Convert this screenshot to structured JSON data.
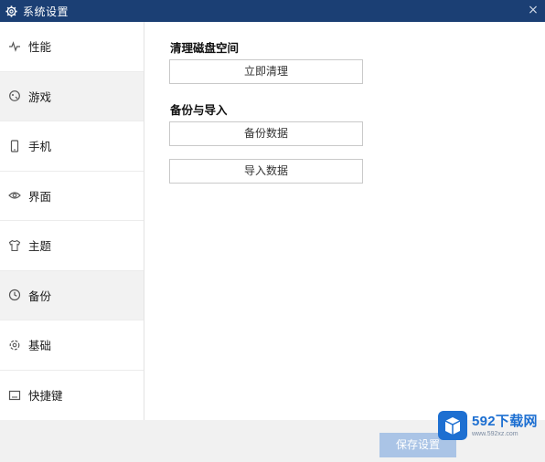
{
  "window": {
    "title": "系统设置",
    "icon": "gear-icon",
    "close_glyph": "×"
  },
  "sidebar": {
    "items": [
      {
        "label": "性能",
        "icon": "pulse-icon",
        "active": false
      },
      {
        "label": "游戏",
        "icon": "gamepad-icon",
        "active": true
      },
      {
        "label": "手机",
        "icon": "phone-icon",
        "active": false
      },
      {
        "label": "界面",
        "icon": "eye-icon",
        "active": false
      },
      {
        "label": "主题",
        "icon": "shirt-icon",
        "active": false
      },
      {
        "label": "备份",
        "icon": "clock-icon",
        "active": true
      },
      {
        "label": "基础",
        "icon": "settings-icon",
        "active": false
      },
      {
        "label": "快捷键",
        "icon": "keyboard-icon",
        "active": false
      }
    ]
  },
  "main": {
    "clean_section": {
      "title": "清理磁盘空间",
      "button_label": "立即清理"
    },
    "backup_section": {
      "title": "备份与导入",
      "backup_button_label": "备份数据",
      "import_button_label": "导入数据"
    }
  },
  "footer": {
    "save_label": "保存设置"
  },
  "watermark": {
    "name": "592下载网",
    "url": "www.592xz.com"
  },
  "colors": {
    "titlebar": "#1b3f74",
    "active_item": "#f2f2f2",
    "save_button": "#aac4e6",
    "watermark_blue": "#1d6fd1"
  }
}
